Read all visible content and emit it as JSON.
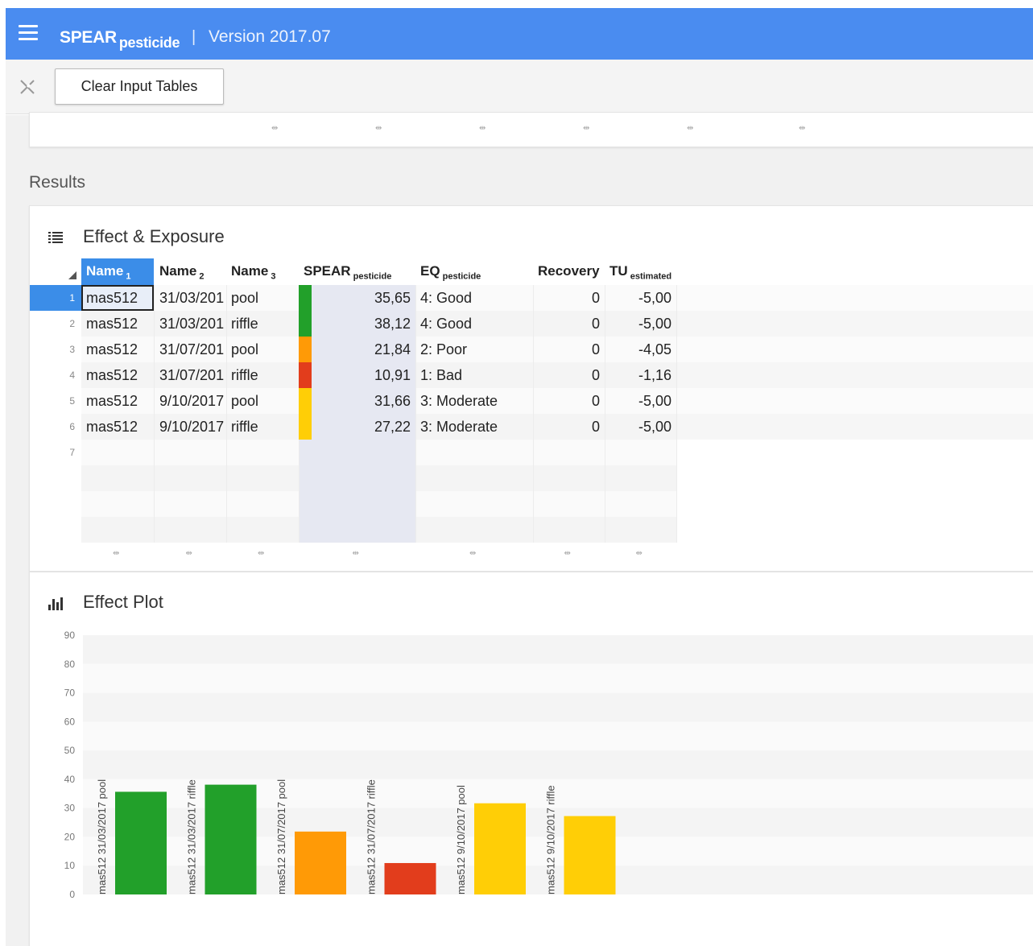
{
  "app": {
    "name": "SPEAR",
    "name_sub": "pesticide",
    "separator": "|",
    "version": "Version 2017.07"
  },
  "toolbar": {
    "clear_label": "Clear Input Tables"
  },
  "results": {
    "heading": "Results"
  },
  "effect_exposure": {
    "title": "Effect & Exposure",
    "icon": "table-list-icon",
    "columns": [
      {
        "main": "Name",
        "sub": "1"
      },
      {
        "main": "Name",
        "sub": "2"
      },
      {
        "main": "Name",
        "sub": "3"
      },
      {
        "main": "SPEAR",
        "sub": "pesticide"
      },
      {
        "main": "EQ",
        "sub": "pesticide"
      },
      {
        "main": "Recovery",
        "sub": ""
      },
      {
        "main": "TU",
        "sub": "estimated"
      }
    ],
    "rows": [
      {
        "n": "1",
        "name1": "mas512",
        "name2": "31/03/201",
        "name3": "pool",
        "color": "#22a02a",
        "spear": "35,65",
        "eq": "4: Good",
        "recovery": "0",
        "tu": "-5,00"
      },
      {
        "n": "2",
        "name1": "mas512",
        "name2": "31/03/201",
        "name3": "riffle",
        "color": "#22a02a",
        "spear": "38,12",
        "eq": "4: Good",
        "recovery": "0",
        "tu": "-5,00"
      },
      {
        "n": "3",
        "name1": "mas512",
        "name2": "31/07/201",
        "name3": "pool",
        "color": "#ff9a06",
        "spear": "21,84",
        "eq": "2: Poor",
        "recovery": "0",
        "tu": "-4,05"
      },
      {
        "n": "4",
        "name1": "mas512",
        "name2": "31/07/201",
        "name3": "riffle",
        "color": "#e23d1c",
        "spear": "10,91",
        "eq": "1: Bad",
        "recovery": "0",
        "tu": "-1,16"
      },
      {
        "n": "5",
        "name1": "mas512",
        "name2": "9/10/2017",
        "name3": "pool",
        "color": "#ffce06",
        "spear": "31,66",
        "eq": "3: Moderate",
        "recovery": "0",
        "tu": "-5,00"
      },
      {
        "n": "6",
        "name1": "mas512",
        "name2": "9/10/2017",
        "name3": "riffle",
        "color": "#ffce06",
        "spear": "27,22",
        "eq": "3: Moderate",
        "recovery": "0",
        "tu": "-5,00"
      },
      {
        "n": "7",
        "name1": "",
        "name2": "",
        "name3": "",
        "color": "",
        "spear": "",
        "eq": "",
        "recovery": "",
        "tu": ""
      }
    ],
    "selected_row": "1",
    "selected_column": "Name 1"
  },
  "effect_plot": {
    "title": "Effect Plot",
    "icon": "bar-chart-icon"
  },
  "colors": {
    "topbar": "#4a8cf0",
    "selection": "#3b8de8",
    "good": "#22a02a",
    "poor": "#ff9a06",
    "bad": "#e23d1c",
    "moderate": "#ffce06"
  },
  "chart_data": {
    "type": "bar",
    "categories": [
      "mas512 31/03/2017 pool",
      "mas512 31/03/2017 riffle",
      "mas512 31/07/2017 pool",
      "mas512 31/07/2017 riffle",
      "mas512 9/10/2017 pool",
      "mas512 9/10/2017 riffle"
    ],
    "values": [
      35.65,
      38.12,
      21.84,
      10.91,
      31.66,
      27.22
    ],
    "colors": [
      "#22a02a",
      "#22a02a",
      "#ff9a06",
      "#e23d1c",
      "#ffce06",
      "#ffce06"
    ],
    "yticks": [
      "0",
      "10",
      "20",
      "30",
      "40",
      "50",
      "60",
      "70",
      "80",
      "90"
    ],
    "ylim": [
      0,
      90
    ],
    "title": "",
    "xlabel": "",
    "ylabel": "",
    "grid": "horizontal bands",
    "legend": "none"
  }
}
